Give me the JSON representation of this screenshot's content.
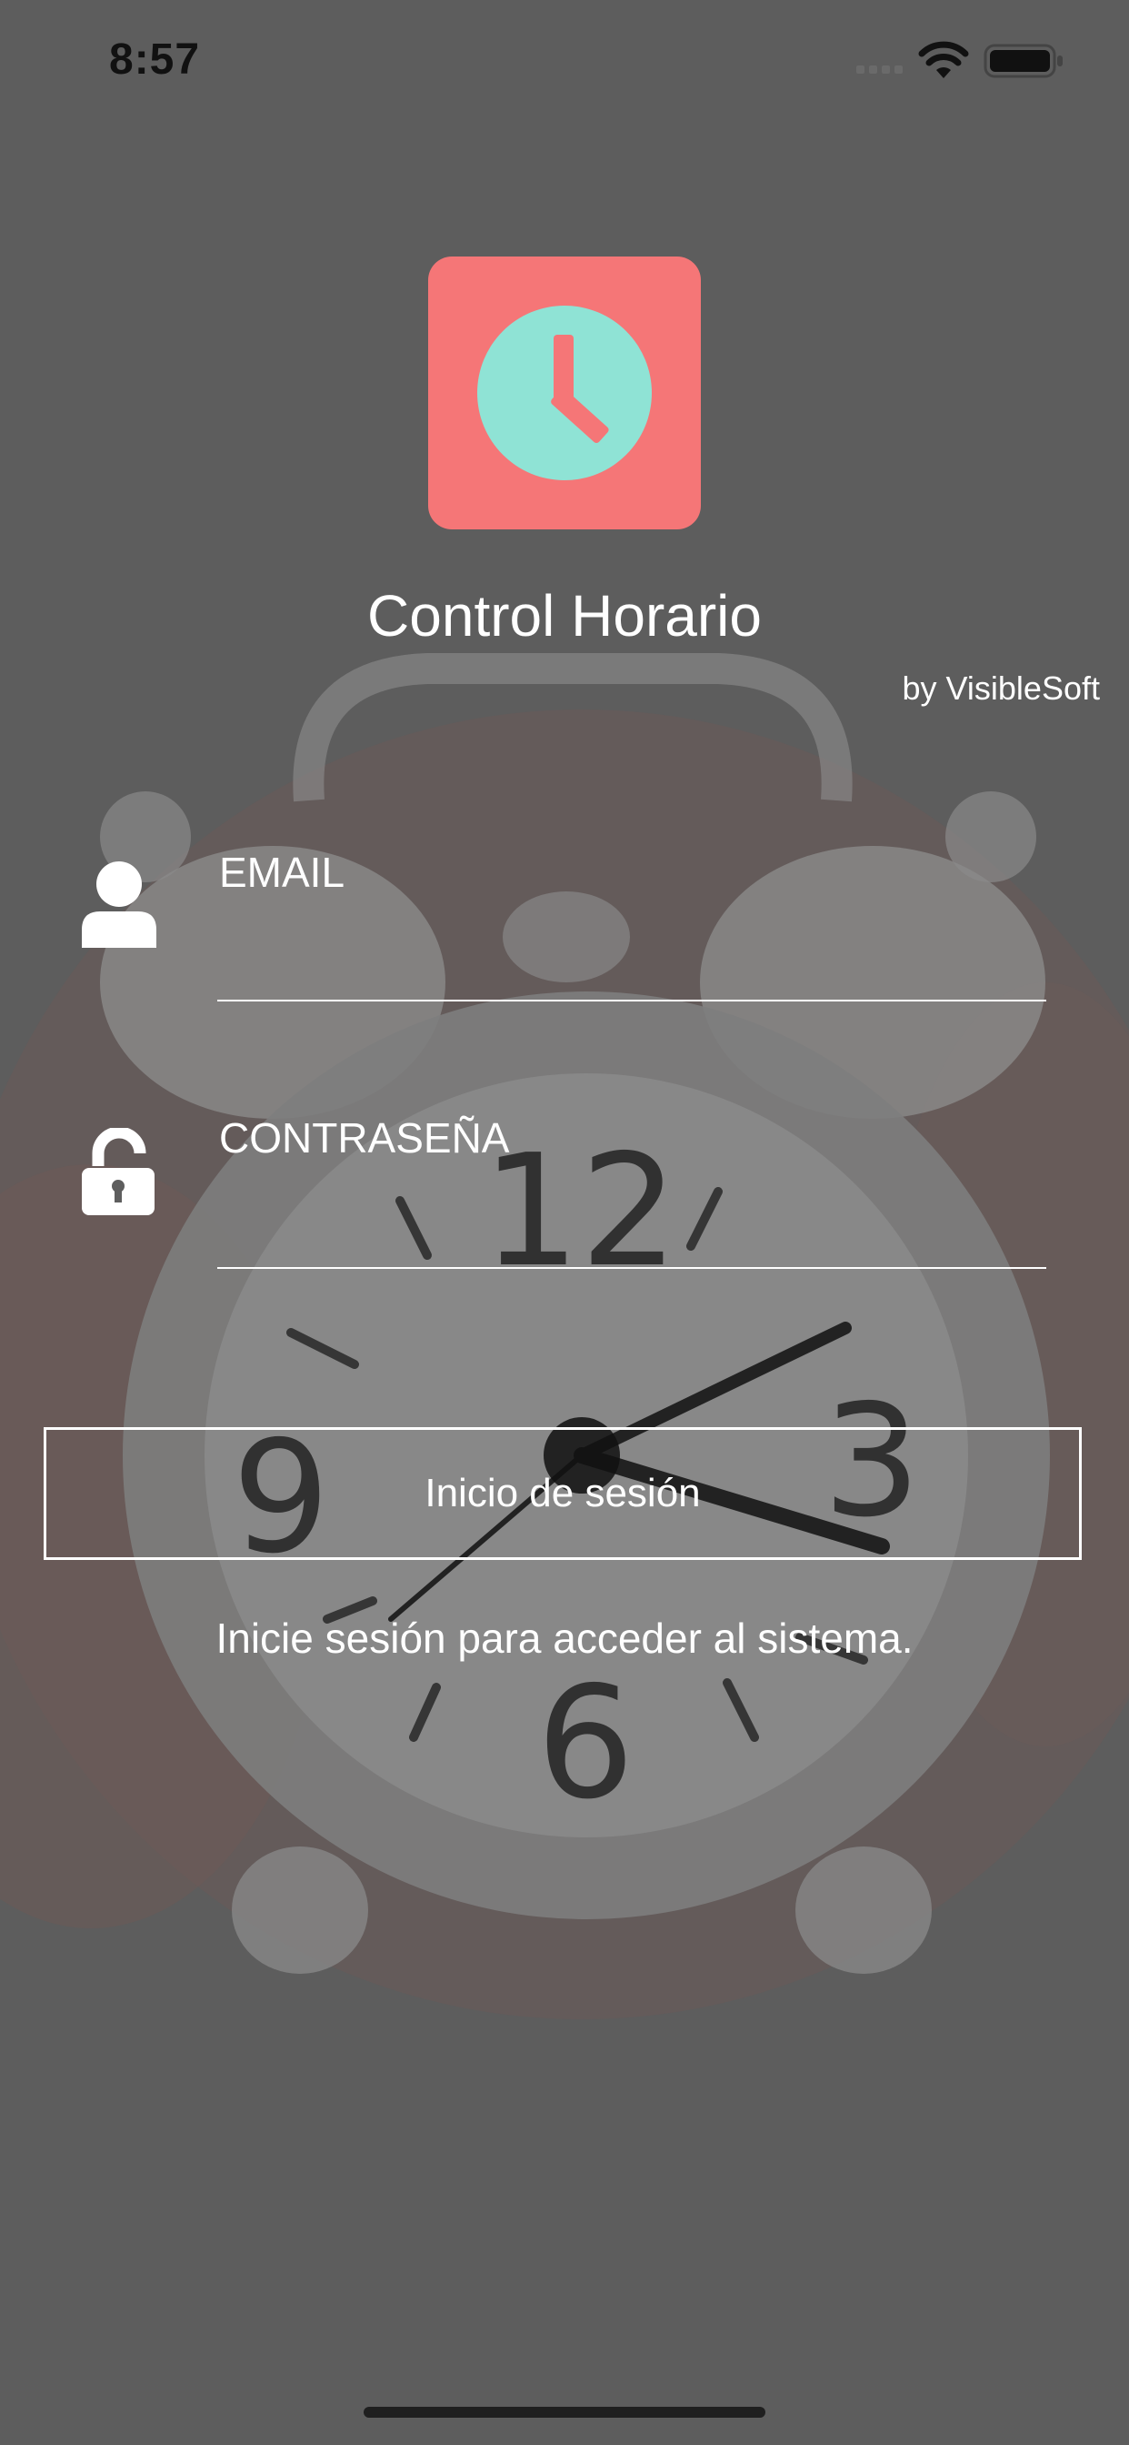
{
  "status_bar": {
    "time": "8:57",
    "icons": [
      "cellular-signal-icon",
      "wifi-icon",
      "battery-icon"
    ]
  },
  "app": {
    "title": "Control Horario",
    "byline": "by VisibleSoft",
    "logo_icon": "clock-icon",
    "colors": {
      "logo_background": "#f57677",
      "clock_face": "#8fe3d5",
      "clock_hands": "#f57677"
    }
  },
  "form": {
    "email": {
      "label": "EMAIL",
      "value": "",
      "icon": "user-icon"
    },
    "password": {
      "label": "CONTRASEÑA",
      "value": "",
      "icon": "unlock-icon"
    },
    "login_label": "Inicio de sesión",
    "hint": "Inicie sesión para acceder al sistema."
  }
}
